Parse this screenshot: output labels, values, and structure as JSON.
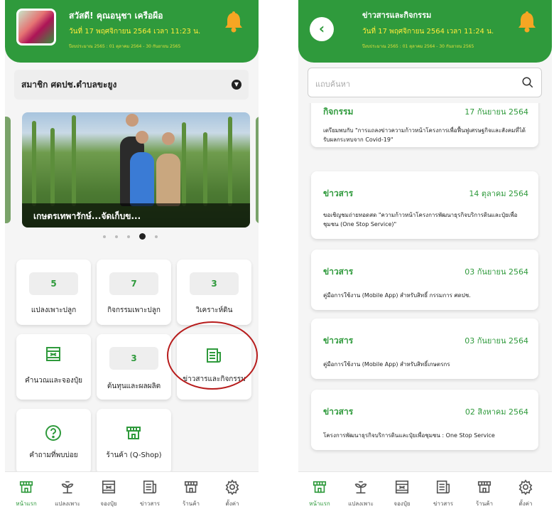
{
  "left": {
    "header": {
      "greeting": "สวัสดี! คุณอนุชา เครือผือ",
      "date": "วันที่ 17 พฤศจิกายน 2564 เวลา 11:23 น.",
      "fiscal": "ปีงบประมาณ 2565 : 01 ตุลาคม 2564 - 30 กันยายน 2565"
    },
    "member_select": "สมาชิก ศดปช.ตำบลขะยูง",
    "carousel": {
      "caption": "เกษตรเทพารักษ์...จัดเก็บข...",
      "dot_count": 5,
      "active_dot": 3
    },
    "tiles": {
      "plots": {
        "count": "5",
        "label": "แปลงเพาะปลูก"
      },
      "activities": {
        "count": "7",
        "label": "กิจกรรมเพาะปลูก"
      },
      "soil": {
        "count": "3",
        "label": "วิเคราะห์ดิน"
      },
      "fertilizer": {
        "label": "คำนวณและจองปุ๋ย",
        "icon": "calculator-icon"
      },
      "cost": {
        "count": "3",
        "label": "ต้นทุนและผลผลิต"
      },
      "news": {
        "label": "ข่าวสารและกิจกรรม",
        "icon": "newspaper-icon"
      },
      "faq": {
        "label": "คำถามที่พบบ่อย",
        "icon": "question-circle-icon"
      },
      "shop": {
        "label": "ร้านค้า (Q-Shop)",
        "icon": "store-icon"
      }
    }
  },
  "right": {
    "header": {
      "title": "ข่าวสารและกิจกรรม",
      "date": "วันที่ 17 พฤศจิกายน 2564 เวลา 11:24 น.",
      "fiscal": "ปีงบประมาณ 2565 : 01 ตุลาคม 2564 - 30 กันยายน 2565"
    },
    "search_placeholder": "แถบค้นหา",
    "news": [
      {
        "type": "กิจกรรม",
        "date": "17 กันยายน 2564",
        "desc": "เตรียมพบกับ \"การแถลงข่าวความก้าวหน้าโครงการเพื่อฟื้นฟูเศรษฐกิจและสังคมที่ได้รับผลกระทบจาก Covid-19\""
      },
      {
        "type": "ข่าวสาร",
        "date": "14 ตุลาคม 2564",
        "desc": "ขอเชิญชมถ่ายทอดสด \"ความก้าวหน้าโครงการพัฒนาธุรกิจบริการดินและปุ๋ยเพื่อชุมชน (One Stop Service)\""
      },
      {
        "type": "ข่าวสาร",
        "date": "03 กันยายน 2564",
        "desc": "คู่มือการใช้งาน (Mobile App) สำหรับสิทธิ์ กรรมการ ศดปช."
      },
      {
        "type": "ข่าวสาร",
        "date": "03 กันยายน 2564",
        "desc": "คู่มือการใช้งาน (Mobile App) สำหรับสิทธิ์เกษตรกร"
      },
      {
        "type": "ข่าวสาร",
        "date": "02 สิงหาคม 2564",
        "desc": "โครงการพัฒนาธุรกิจบริการดินและปุ๋ยเพื่อชุมชน : One Stop Service"
      }
    ]
  },
  "nav": [
    {
      "label": "หน้าแรก",
      "icon": "home-store-icon"
    },
    {
      "label": "แปลงเพาะ",
      "icon": "plant-icon"
    },
    {
      "label": "จองปุ๋ย",
      "icon": "calculator-icon"
    },
    {
      "label": "ข่าวสาร",
      "icon": "newspaper-icon"
    },
    {
      "label": "ร้านค้า",
      "icon": "store-icon"
    },
    {
      "label": "ตั้งค่า",
      "icon": "gear-icon"
    }
  ],
  "colors": {
    "primary": "#2f9a3c",
    "accent_text": "#ffeb3b",
    "highlight_circle": "#b71c1c",
    "bell": "#f5a623"
  }
}
